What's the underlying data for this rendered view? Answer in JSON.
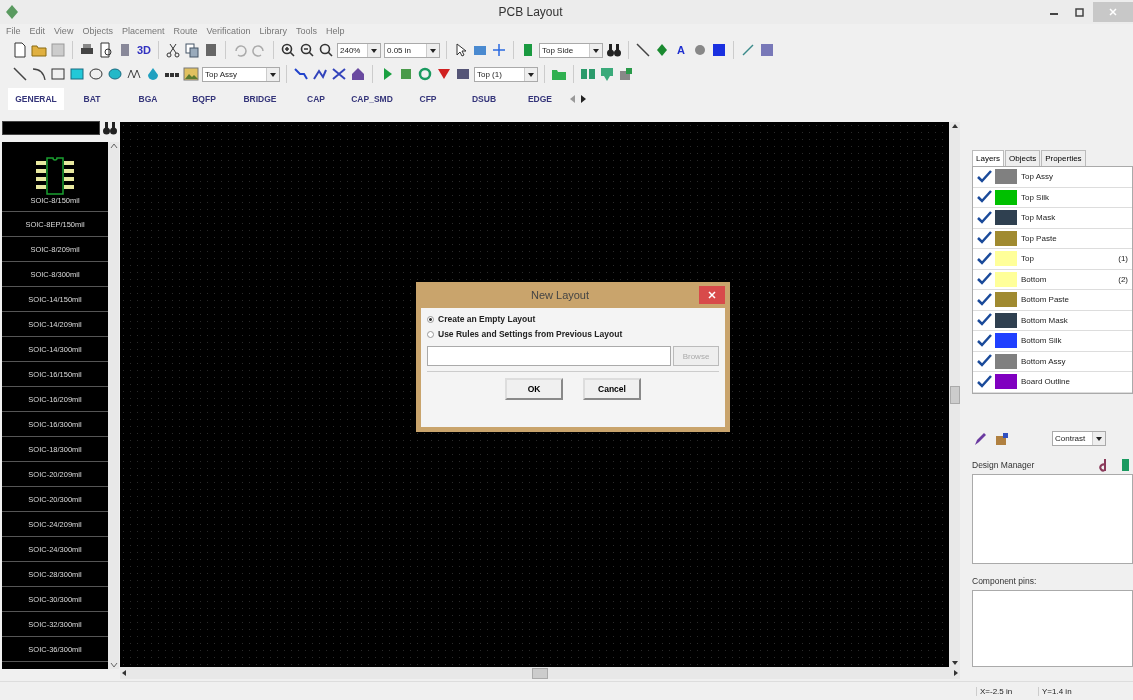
{
  "window": {
    "title": "PCB Layout"
  },
  "menu": [
    "File",
    "Edit",
    "View",
    "Objects",
    "Placement",
    "Route",
    "Verification",
    "Library",
    "Tools",
    "Help"
  ],
  "toolbar": {
    "view_3d": "3D",
    "zoom": "240%",
    "grid": "0.05 in",
    "side": "Top Side",
    "text_tool": "A"
  },
  "drawing_toolbar": {
    "layer": "Top Assy",
    "copper_layer": "Top (1)"
  },
  "library_tabs": [
    {
      "label": "GENERAL",
      "selected": true
    },
    {
      "label": "BAT",
      "selected": false
    },
    {
      "label": "BGA",
      "selected": false
    },
    {
      "label": "BQFP",
      "selected": false
    },
    {
      "label": "BRIDGE",
      "selected": false
    },
    {
      "label": "CAP",
      "selected": false
    },
    {
      "label": "CAP_SMD",
      "selected": false
    },
    {
      "label": "CFP",
      "selected": false
    },
    {
      "label": "DSUB",
      "selected": false
    },
    {
      "label": "EDGE",
      "selected": false
    }
  ],
  "components": [
    {
      "name": "SOIC-8/150mil",
      "kind": "preview"
    },
    {
      "name": "SOIC-8EP/150mil",
      "kind": "plain"
    },
    {
      "name": "SOIC-8/209mil",
      "kind": "plain"
    },
    {
      "name": "SOIC-8/300mil",
      "kind": "plain"
    },
    {
      "name": "SOIC-14/150mil",
      "kind": "plain"
    },
    {
      "name": "SOIC-14/209mil",
      "kind": "plain"
    },
    {
      "name": "SOIC-14/300mil",
      "kind": "plain"
    },
    {
      "name": "SOIC-16/150mil",
      "kind": "plain"
    },
    {
      "name": "SOIC-16/209mil",
      "kind": "plain"
    },
    {
      "name": "SOIC-16/300mil",
      "kind": "plain"
    },
    {
      "name": "SOIC-18/300mil",
      "kind": "plain"
    },
    {
      "name": "SOIC-20/209mil",
      "kind": "plain"
    },
    {
      "name": "SOIC-20/300mil",
      "kind": "plain"
    },
    {
      "name": "SOIC-24/209mil",
      "kind": "plain"
    },
    {
      "name": "SOIC-24/300mil",
      "kind": "plain"
    },
    {
      "name": "SOIC-28/300mil",
      "kind": "plain"
    },
    {
      "name": "SOIC-30/300mil",
      "kind": "plain"
    },
    {
      "name": "SOIC-32/300mil",
      "kind": "plain"
    },
    {
      "name": "SOIC-36/300mil",
      "kind": "plain"
    }
  ],
  "panel_tabs": [
    {
      "label": "Layers",
      "selected": true
    },
    {
      "label": "Objects",
      "selected": false
    },
    {
      "label": "Properties",
      "selected": false
    }
  ],
  "layers": [
    {
      "name": "Top Assy",
      "color": "#808080",
      "checked": true
    },
    {
      "name": "Top Silk",
      "color": "#00c000",
      "checked": true
    },
    {
      "name": "Top Mask",
      "color": "#2f4050",
      "checked": true
    },
    {
      "name": "Top Paste",
      "color": "#a08a30",
      "checked": true
    },
    {
      "name": "Top",
      "color": "#ffff99",
      "checked": true,
      "number": "(1)"
    },
    {
      "name": "Bottom",
      "color": "#ffff99",
      "checked": true,
      "number": "(2)"
    },
    {
      "name": "Bottom Paste",
      "color": "#a08a30",
      "checked": true
    },
    {
      "name": "Bottom Mask",
      "color": "#2f4050",
      "checked": true
    },
    {
      "name": "Bottom Silk",
      "color": "#2040ff",
      "checked": true
    },
    {
      "name": "Bottom Assy",
      "color": "#808080",
      "checked": true
    },
    {
      "name": "Board Outline",
      "color": "#8000c0",
      "checked": true
    }
  ],
  "contrast": "Contrast",
  "design_manager": {
    "title": "Design Manager"
  },
  "component_pins": {
    "title": "Component pins:"
  },
  "dialog": {
    "title": "New Layout",
    "options": [
      {
        "label": "Create an Empty Layout",
        "selected": true
      },
      {
        "label": "Use Rules and Settings from Previous Layout",
        "selected": false
      }
    ],
    "browse": {
      "label": "Browse",
      "disabled": true
    },
    "buttons": [
      "OK",
      "Cancel"
    ]
  },
  "status_bar": {
    "x": "X=-2.5 in",
    "y": "Y=1.4 in"
  }
}
